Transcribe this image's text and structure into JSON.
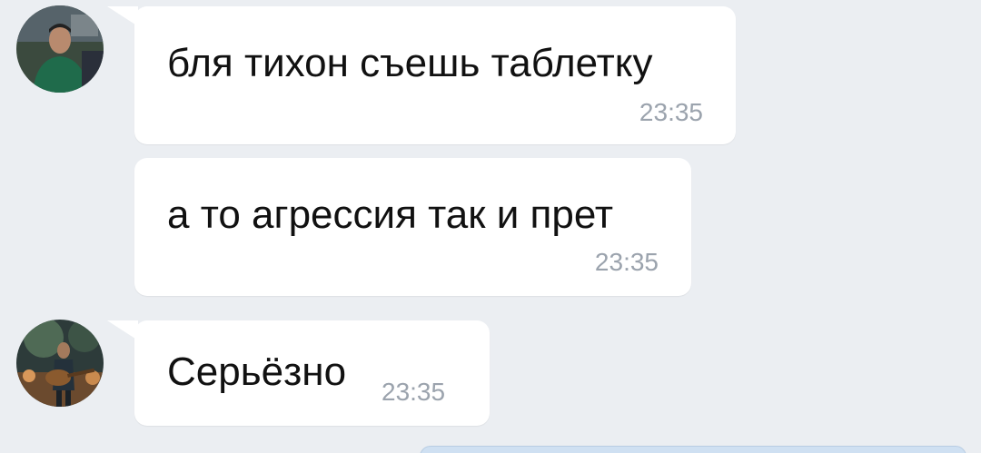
{
  "colors": {
    "background": "#ebeef2",
    "bubble_incoming": "#ffffff",
    "bubble_outgoing": "#cfe0f2",
    "text": "#111111",
    "timestamp": "#9ba3ad"
  },
  "messages": [
    {
      "sender": "contact-1",
      "text": "бля тихон съешь таблетку",
      "time": "23:35",
      "avatar_icon": "user-photo-avatar"
    },
    {
      "sender": "contact-1",
      "text": "а то агрессия так и прет",
      "time": "23:35"
    },
    {
      "sender": "contact-2",
      "text": "Серьёзно",
      "time": "23:35",
      "avatar_icon": "guitar-player-photo-avatar"
    }
  ]
}
